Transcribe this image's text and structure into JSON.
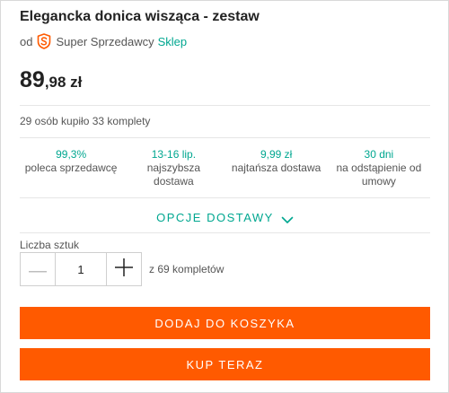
{
  "product": {
    "title": "Elegancka donica wisząca - zestaw"
  },
  "seller": {
    "prefix": "od",
    "badge_icon": "super-seller-badge",
    "badge_color": "#ff5a00",
    "label": "Super Sprzedawcy",
    "shop_link": "Sklep"
  },
  "price": {
    "integer": "89",
    "fraction": ",98 zł"
  },
  "sales": {
    "text": "29 osób kupiło 33 komplety"
  },
  "features": [
    {
      "value": "99,3%",
      "label": "poleca sprzedawcę"
    },
    {
      "value": "13-16 lip.",
      "label": "najszybsza dostawa"
    },
    {
      "value": "9,99 zł",
      "label": "najtańsza dostawa"
    },
    {
      "value": "30 dni",
      "label": "na odstąpienie od umowy"
    }
  ],
  "delivery": {
    "label": "OPCJE DOSTAWY",
    "icon": "chevron-down-icon"
  },
  "quantity": {
    "label": "Liczba sztuk",
    "value": "1",
    "available": "z 69 kompletów",
    "minus_icon": "minus-icon",
    "plus_icon": "plus-icon"
  },
  "actions": {
    "add_to_cart": "DODAJ DO KOSZYKA",
    "buy_now": "KUP TERAZ"
  },
  "colors": {
    "accent": "#00a790",
    "cta": "#ff5a00"
  }
}
